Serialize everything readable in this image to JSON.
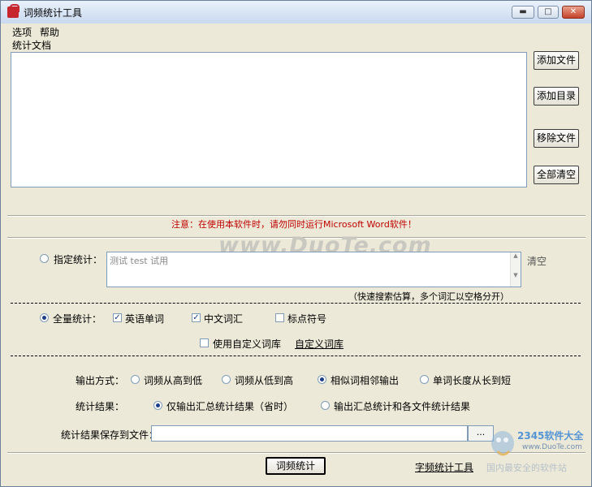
{
  "window": {
    "title": "词频统计工具",
    "controls": {
      "minimize": "▬",
      "maximize": "□",
      "close": "✕"
    }
  },
  "menu": {
    "options": "选项",
    "help": "帮助"
  },
  "documents": {
    "group_label": "统计文档",
    "add_file": "添加文件",
    "add_folder": "添加目录",
    "remove_file": "移除文件",
    "clear_all": "全部清空"
  },
  "notice": "注意：在使用本软件时，请勿同时运行Microsoft Word软件！",
  "watermark": "www.DuoTe.com",
  "specified": {
    "label": "指定统计：",
    "text_value": "测试 test 试用",
    "clear": "清空",
    "hint": "（快速搜索估算，多个词汇以空格分开）",
    "selected": false
  },
  "full": {
    "label": "全量统计：",
    "selected": true,
    "english_words": {
      "label": "英语单词",
      "checked": true
    },
    "chinese_words": {
      "label": "中文词汇",
      "checked": true
    },
    "punctuation": {
      "label": "标点符号",
      "checked": false
    },
    "custom_dict": {
      "label": "使用自定义词库",
      "checked": false
    },
    "custom_dict_link": "自定义词库"
  },
  "output": {
    "mode_label": "输出方式：",
    "modes": [
      "词频从高到低",
      "词频从低到高",
      "相似词相邻输出",
      "单词长度从长到短"
    ],
    "selected_mode": 2,
    "result_label": "统计结果：",
    "results": [
      "仅输出汇总统计结果（省时）",
      "输出汇总统计和各文件统计结果"
    ],
    "selected_result": 0,
    "save_label": "统计结果保存到文件：",
    "save_value": "",
    "browse": "..."
  },
  "footer": {
    "run": "词频统计",
    "char_tool": "字频统计工具"
  },
  "site_watermark": {
    "brand": "2345软件大全",
    "url": "www.DuoTe.com",
    "tagline": "国内最安全的软件站"
  },
  "colors": {
    "notice": "#c00000",
    "accent": "#1b3d8a"
  }
}
